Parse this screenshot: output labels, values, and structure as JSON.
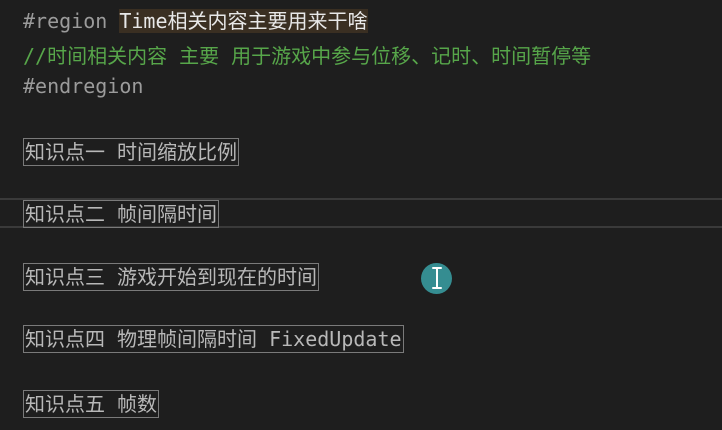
{
  "editor": {
    "region_line": {
      "directive": "#region ",
      "name_ascii": "Time",
      "name_cjk": "相关内容主要用来干啥"
    },
    "comment_line": "//时间相关内容 主要 用于游戏中参与位移、记时、时间暂停等",
    "endregion_line": "#endregion",
    "knowledge_points": [
      {
        "text": "知识点一 时间缩放比例"
      },
      {
        "text": "知识点二 帧间隔时间"
      },
      {
        "text": "知识点三 游戏开始到现在的时间"
      },
      {
        "text": "知识点四 物理帧间隔时间 FixedUpdate"
      },
      {
        "text": "知识点五 帧数"
      }
    ]
  },
  "cursor": {
    "icon": "text-cursor-icon",
    "color": "#3aa1a6"
  },
  "colors": {
    "background": "#1e1e1e",
    "directive": "#9b9b9b",
    "comment": "#57a64a",
    "text": "#b8b8b8",
    "box_border": "#7a7a7a"
  }
}
